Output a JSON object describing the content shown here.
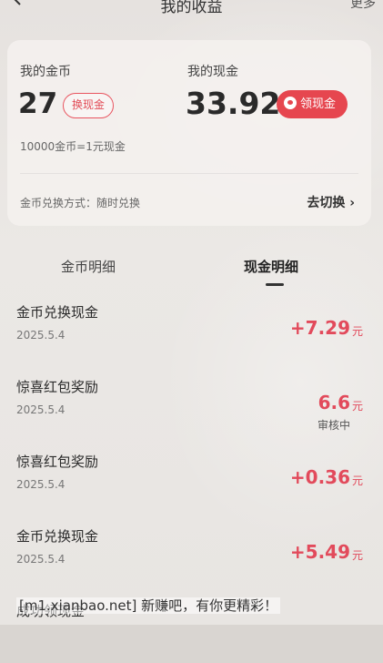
{
  "header": {
    "title": "我的收益",
    "more": "更多"
  },
  "wallet": {
    "coin_label": "我的金币",
    "coin_value": "27",
    "exchange_button": "换现金",
    "cash_label": "我的现金",
    "cash_value": "33.92",
    "withdraw_button": "领现金",
    "rate_text": "10000金币=1元现金",
    "method_text": "金币兑换方式：随时兑换",
    "switch_link": "去切换 ›"
  },
  "tabs": {
    "coin_detail": "金币明细",
    "cash_detail": "现金明细"
  },
  "records": [
    {
      "title": "金币兑换现金",
      "date": "2025.5.4",
      "amount": "+7.29",
      "unit": "元",
      "status": ""
    },
    {
      "title": "惊喜红包奖励",
      "date": "2025.5.4",
      "amount": "6.6",
      "unit": "元",
      "status": "审核中"
    },
    {
      "title": "惊喜红包奖励",
      "date": "2025.5.4",
      "amount": "+0.36",
      "unit": "元",
      "status": ""
    },
    {
      "title": "金币兑换现金",
      "date": "2025.5.4",
      "amount": "+5.49",
      "unit": "元",
      "status": ""
    },
    {
      "title": "成功领现金",
      "date": "",
      "amount": "",
      "unit": "",
      "status": ""
    }
  ],
  "watermark": "[m1.xianbao.net] 新赚吧，有你更精彩！",
  "colors": {
    "accent": "#e6464f",
    "amount": "#e24a5b"
  }
}
